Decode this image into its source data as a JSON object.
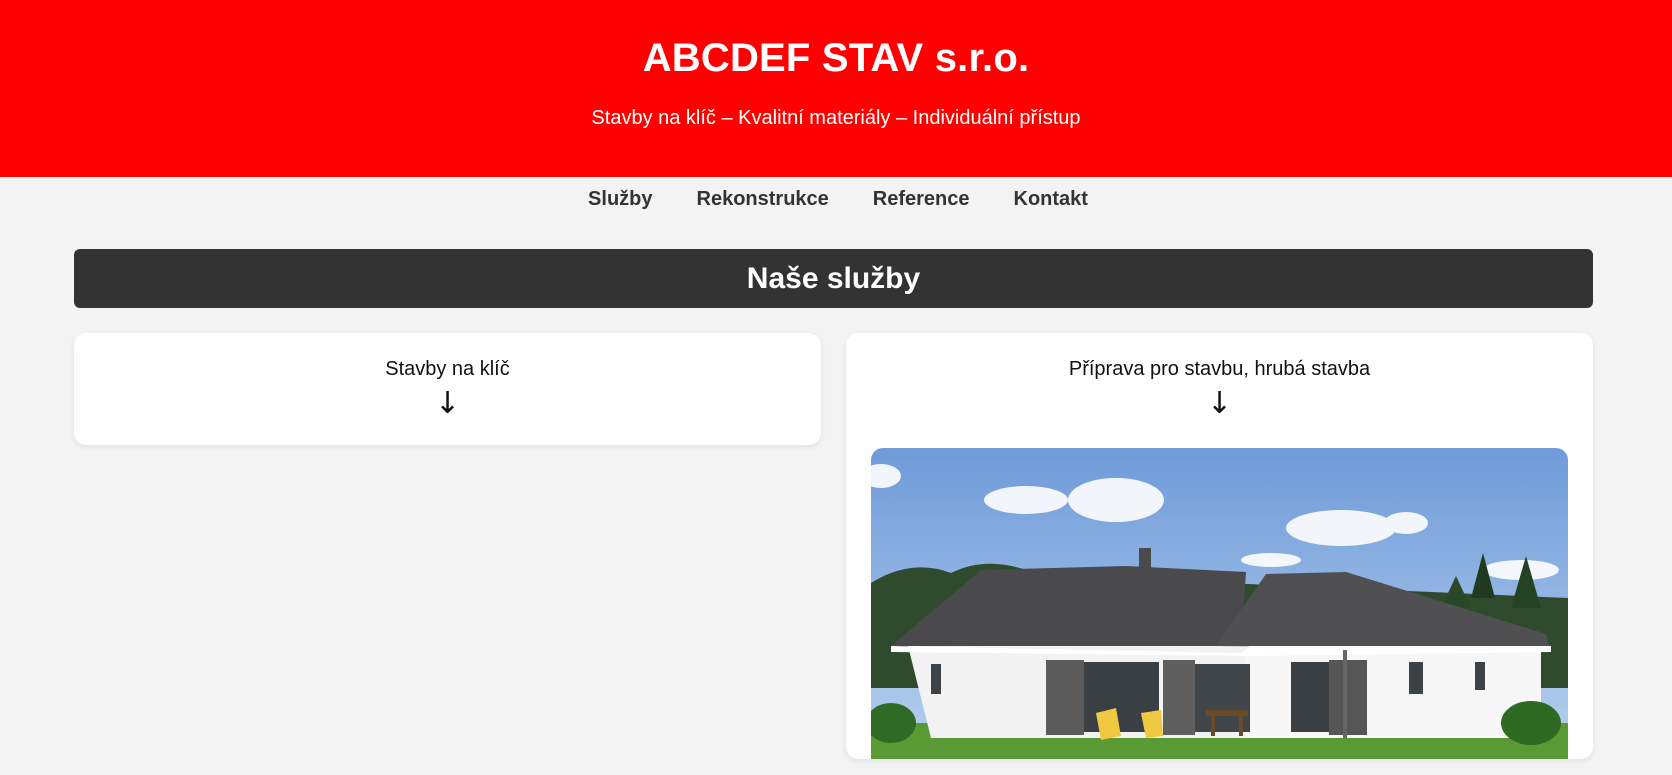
{
  "header": {
    "title": "ABCDEF STAV s.r.o.",
    "tagline": "Stavby na klíč – Kvalitní materiály – Individuální přístup",
    "background_color": "#ff0000"
  },
  "nav": {
    "items": [
      {
        "label": "Služby"
      },
      {
        "label": "Rekonstrukce"
      },
      {
        "label": "Reference"
      },
      {
        "label": "Kontakt"
      }
    ]
  },
  "services": {
    "heading": "Naše služby",
    "cards": [
      {
        "title": "Stavby na klíč",
        "arrow": "↓"
      },
      {
        "title": "Příprava pro stavbu, hrubá stavba",
        "arrow": "↓",
        "image": "bungalow-house-photo"
      }
    ]
  },
  "colors": {
    "accent": "#ff0000",
    "bar": "#333333",
    "page_bg": "#f3f3f3"
  }
}
